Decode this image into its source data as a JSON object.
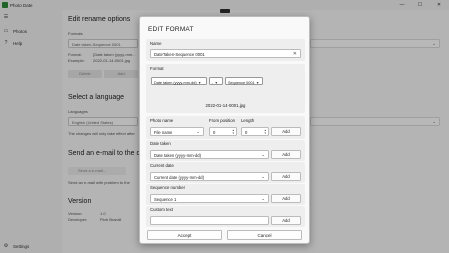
{
  "window": {
    "app_title": "Photo Date",
    "minimize_glyph": "—",
    "maximize_glyph": "☐",
    "close_glyph": "✕"
  },
  "sidebar": {
    "menu_glyph": "☰",
    "items": [
      {
        "icon": "photo-icon",
        "glyph": "▭",
        "label": "Photos"
      },
      {
        "icon": "help-icon",
        "glyph": "?",
        "label": "Help"
      }
    ],
    "settings": {
      "icon": "gear-icon",
      "glyph": "⚙",
      "label": "Settings"
    }
  },
  "main": {
    "rename_title": "Edit rename options",
    "formats_label": "Formats",
    "format_value": "Date taken-Sequence 0001",
    "format_row_label": "Format:",
    "format_row_value": "{Date taken (yyyy-mm...",
    "example_row_label": "Example:",
    "example_row_value": "2022-01-14-0001.jpg",
    "delete_label": "Delete",
    "add_label": "Add",
    "language_title": "Select a language",
    "languages_label": "Languages",
    "language_value": "English (United States)",
    "language_note": "The changes will only take effect after",
    "email_title": "Send an e-mail to the devel",
    "email_placeholder": "Send a e-mail...",
    "email_note": "Send an e-mail with problem to the",
    "version_title": "Version",
    "version_label": "Version:",
    "version_value": "1.0",
    "developer_label": "Developer:",
    "developer_value": "Piotr Brandt"
  },
  "dialog": {
    "title": "EDIT FORMAT",
    "name_label": "Name",
    "name_value": "DateTaken-Sequence 0001",
    "clear_glyph": "✕",
    "format_label": "Format",
    "chips": [
      "Date taken (yyyy-mm-dd)",
      "-",
      "Sequence 0001"
    ],
    "preview": "2022-01-14-0001.jpg",
    "photo_name_label": "Photo name",
    "from_position_label": "From position",
    "length_label": "Length",
    "photo_name_value": "File name",
    "from_position_value": "0",
    "length_value": "0",
    "date_taken_label": "Date taken",
    "date_taken_value": "Date taken (yyyy-mm-dd)",
    "current_date_label": "Current date",
    "current_date_value": "Current date (yyyy-mm-dd)",
    "sequence_label": "Sequence number",
    "sequence_value": "Sequence 1",
    "custom_text_label": "Custom text",
    "custom_text_value": "",
    "add_label": "Add",
    "accept_label": "Accept",
    "cancel_label": "Cancel"
  }
}
